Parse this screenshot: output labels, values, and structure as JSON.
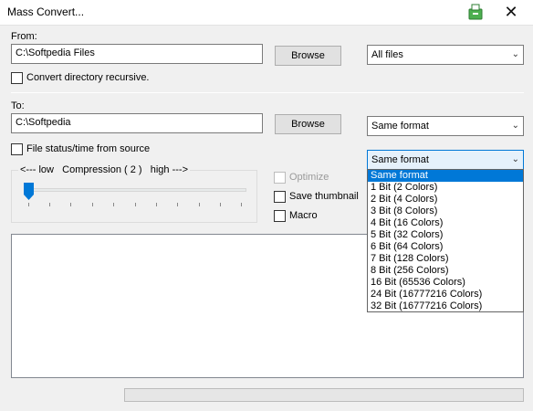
{
  "window": {
    "title": "Mass Convert...",
    "close_glyph": "✕"
  },
  "from": {
    "label": "From:",
    "path": "C:\\Softpedia Files",
    "browse_label": "Browse",
    "filter_selected": "All files",
    "recursive_label": "Convert directory recursive."
  },
  "to": {
    "label": "To:",
    "path": "C:\\Softpedia",
    "browse_label": "Browse",
    "format_selected": "Same format",
    "file_status_label": "File status/time from source"
  },
  "compression": {
    "low_label": "<--- low",
    "title_label": "Compression ( 2 )",
    "high_label": "high --->"
  },
  "options": {
    "optimize_label": "Optimize",
    "save_thumbnail_label": "Save thumbnail",
    "macro_label": "Macro"
  },
  "color_depth": {
    "selected": "Same format",
    "options": [
      "Same format",
      "1 Bit (2 Colors)",
      "2 Bit (4 Colors)",
      "3 Bit (8 Colors)",
      "4 Bit (16 Colors)",
      "5 Bit (32 Colors)",
      "6 Bit (64 Colors)",
      "7 Bit (128 Colors)",
      "8 Bit (256 Colors)",
      "16 Bit (65536 Colors)",
      "24 Bit (16777216 Colors)",
      "32 Bit (16777216 Colors)"
    ],
    "highlighted_index": 0
  },
  "colors": {
    "accent": "#0078d7",
    "slider_thumb": "#0078d7",
    "app_icon": "#4caf50"
  }
}
